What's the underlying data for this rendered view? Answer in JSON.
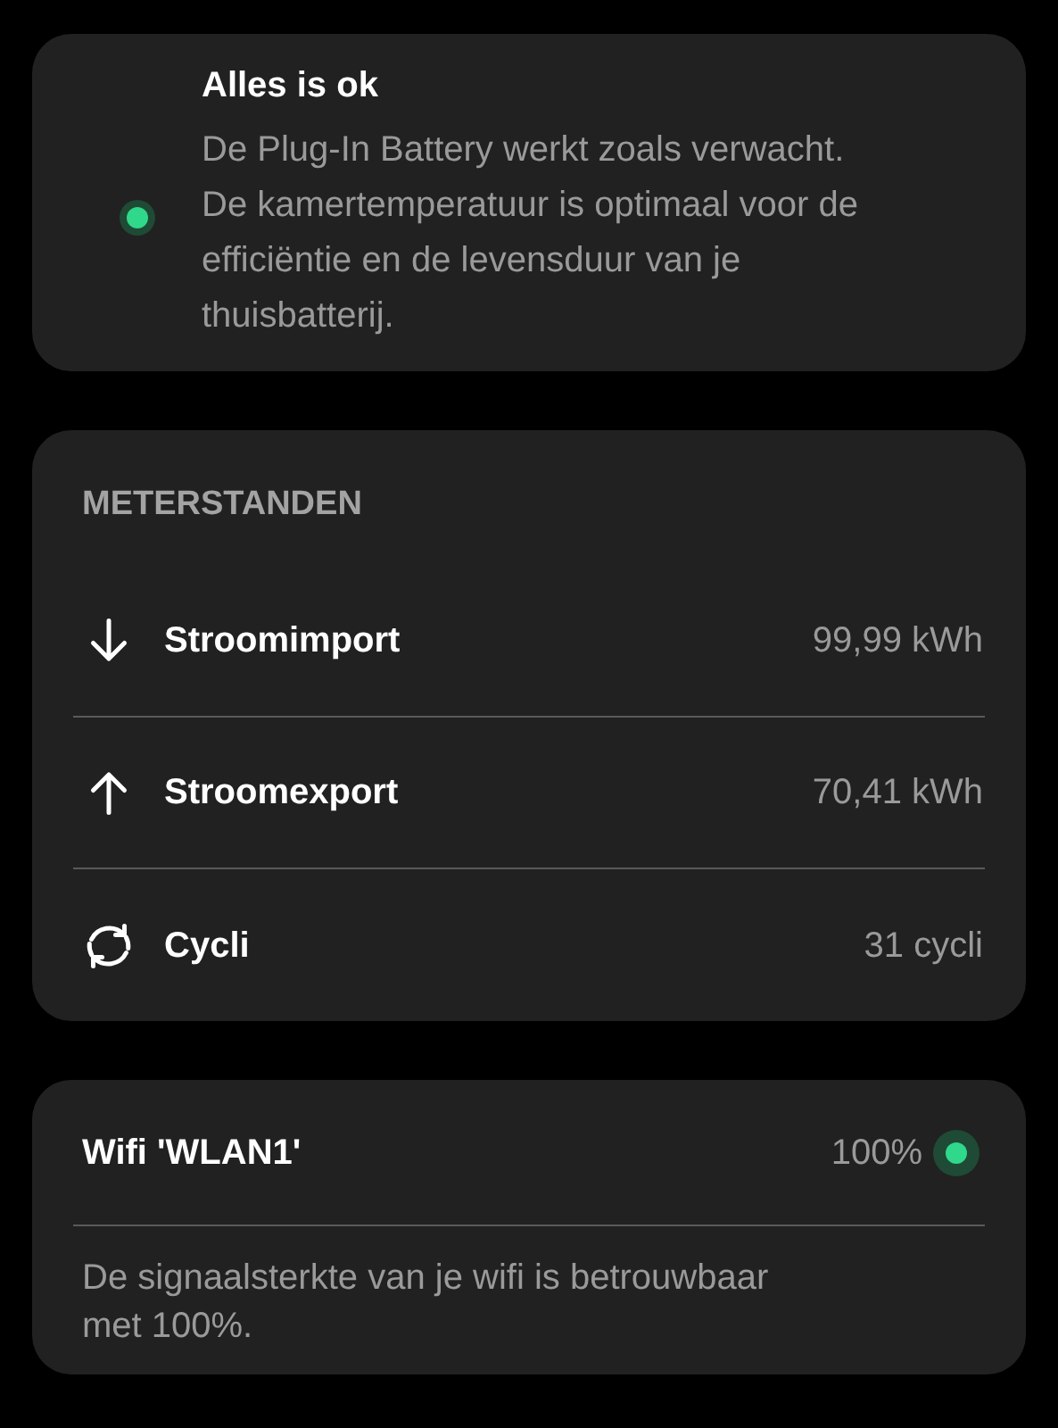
{
  "status_card": {
    "ok": true,
    "title": "Alles is ok",
    "message": "De Plug-In Battery werkt zoals verwacht. De kamertemperatuur is optimaal voor de efficiëntie en de levensduur van je thuisbatterij."
  },
  "meter_card": {
    "heading": "METERSTANDEN",
    "rows": [
      {
        "kind": "import",
        "label": "Stroomimport",
        "value": "99,99 kWh"
      },
      {
        "kind": "export",
        "label": "Stroomexport",
        "value": "70,41 kWh"
      },
      {
        "kind": "cycles",
        "label": "Cycli",
        "value": "31 cycli"
      }
    ]
  },
  "wifi_card": {
    "title": "Wifi 'WLAN1'",
    "strength": "100%",
    "ok": true,
    "message": "De signaalsterkte van je wifi is betrouwbaar met 100%."
  }
}
